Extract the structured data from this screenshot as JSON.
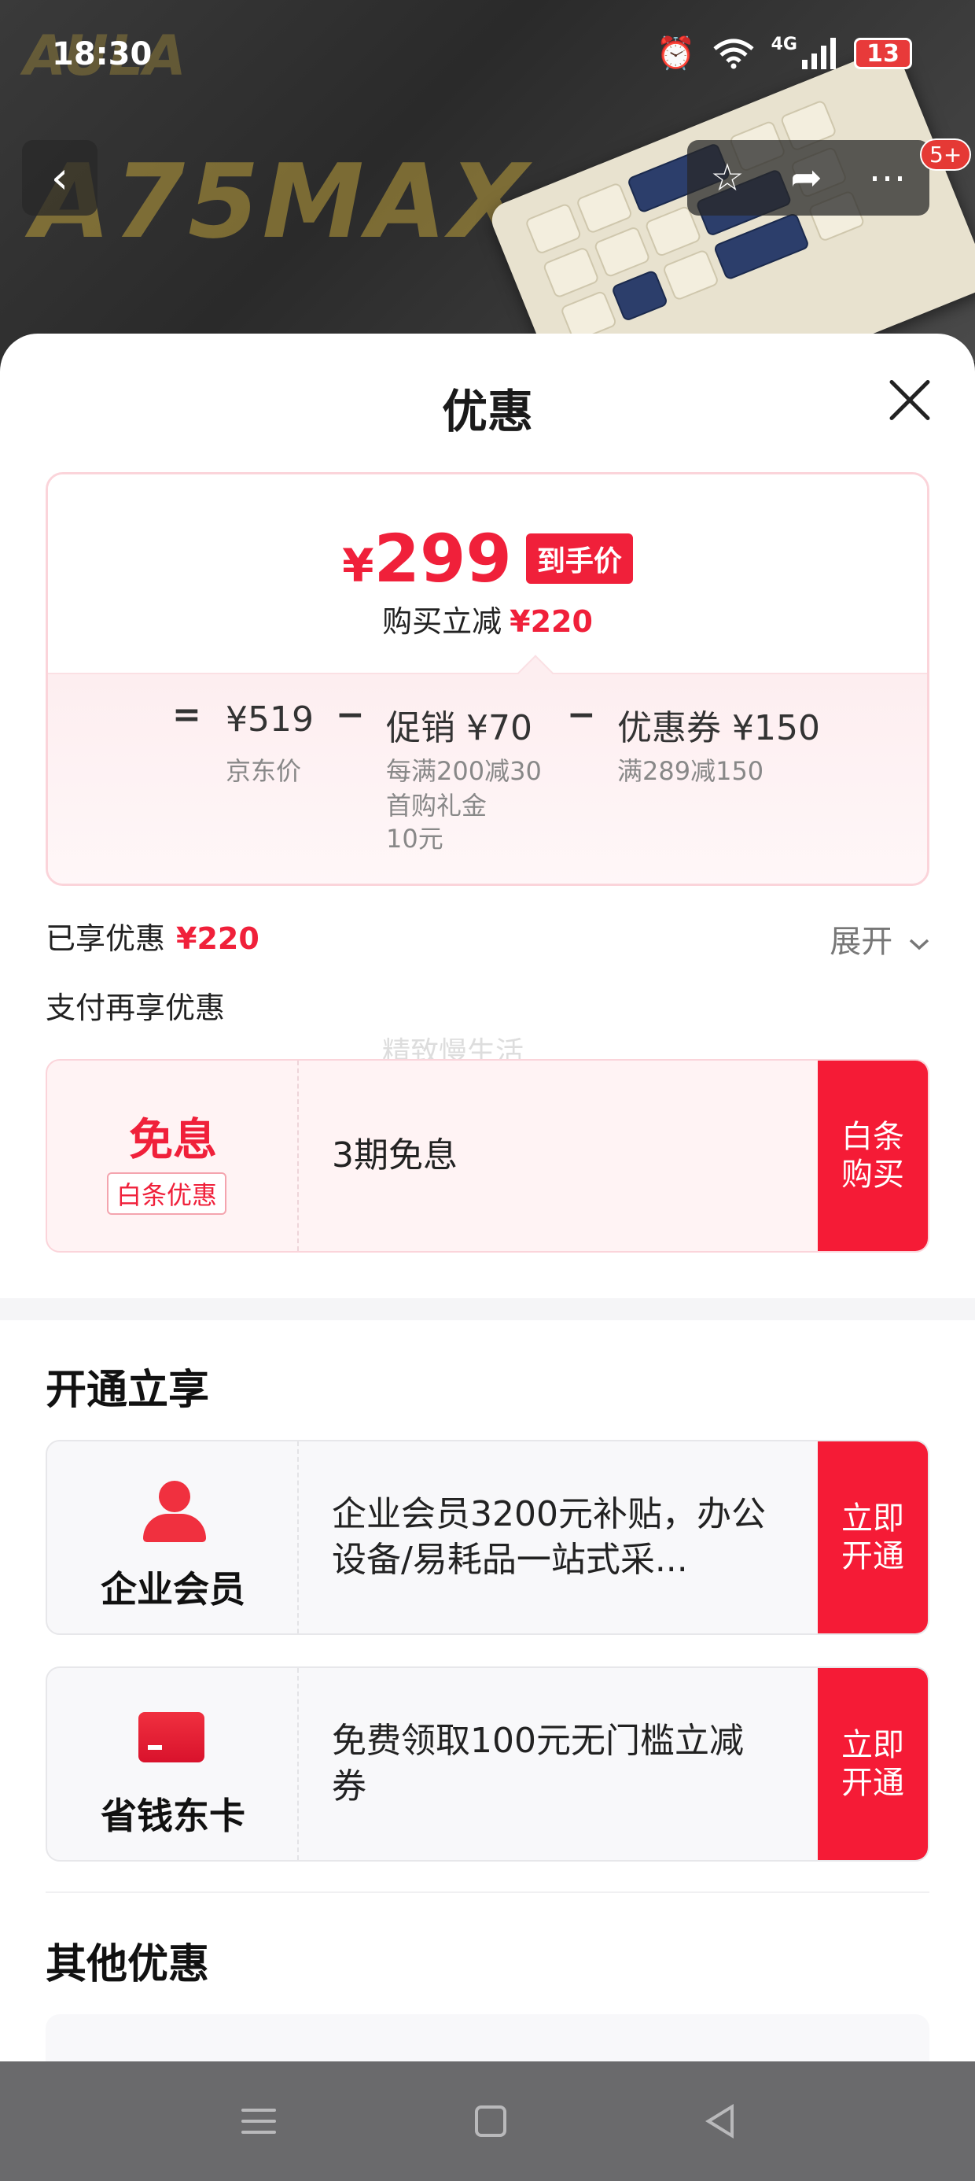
{
  "status_bar": {
    "time": "18:30",
    "network": "4G",
    "battery": "13",
    "icons": [
      "alarm-icon",
      "wifi-icon",
      "signal-icon",
      "battery-icon"
    ]
  },
  "hero": {
    "brand_watermark": "A75MAX",
    "brand_small": "AULA",
    "notification_badge": "5+"
  },
  "sheet": {
    "title": "优惠",
    "price_card": {
      "final_price_symbol": "¥",
      "final_price_value": "299",
      "final_price_tag": "到手价",
      "reduce_label": "购买立减",
      "reduce_amount": "¥220",
      "equals": "=",
      "minus": "−",
      "components": [
        {
          "main": "¥519",
          "sub": "京东价"
        },
        {
          "main": "促销 ¥70",
          "sub": "每满200减30",
          "sub2": "首购礼金",
          "sub3": "10元"
        },
        {
          "main": "优惠券 ¥150",
          "sub": "满289减150"
        }
      ]
    },
    "enjoyed_label": "已享优惠",
    "enjoyed_amount": "¥220",
    "expand_label": "展开",
    "pay_more_label": "支付再享优惠",
    "watermark": "精致慢生活",
    "baitiao_card": {
      "title": "免息",
      "tag": "白条优惠",
      "desc": "3期免息",
      "cta": "白条\n购买"
    },
    "open_section_title": "开通立享",
    "member_card": {
      "label": "企业会员",
      "desc": "企业会员3200元补贴，办公设备/易耗品一站式采...",
      "cta": "立即\n开通"
    },
    "dongka_card": {
      "label": "省钱东卡",
      "desc": "免费领取100元无门槛立减券",
      "cta": "立即\n开通"
    },
    "other_section_title": "其他优惠"
  },
  "colors": {
    "accent_red": "#f0203a",
    "cta_red": "#f51b36",
    "navbar_gray": "#6a6a6c"
  }
}
